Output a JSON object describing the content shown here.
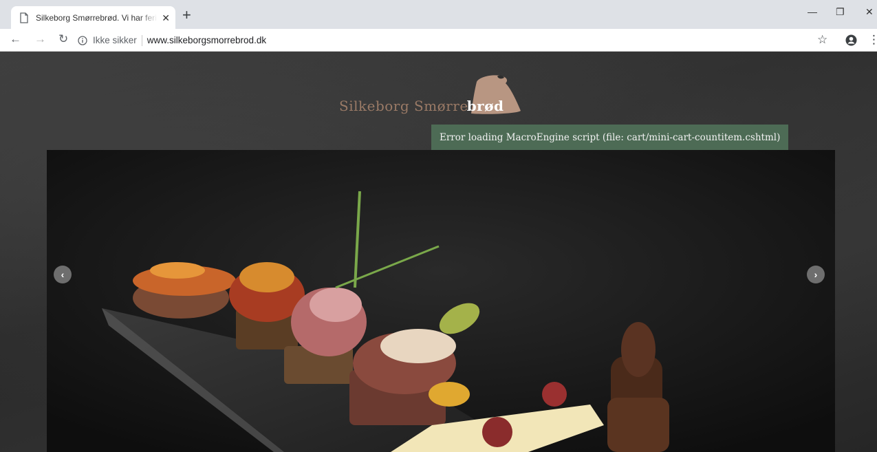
{
  "browser": {
    "tab_title": "Silkeborg Smørrebrød. Vi har ferie",
    "tab_close": "✕",
    "new_tab": "+",
    "minimize": "—",
    "restore": "❐",
    "close": "✕",
    "back": "←",
    "forward": "→",
    "reload": "↻",
    "security_label": "Ikke sikker",
    "url": "www.silkeborgsmorrebrod.dk",
    "bookmark": "☆",
    "menu": "⋮"
  },
  "site": {
    "logo_part1": "Silkeborg Smørre",
    "logo_part2": "brød",
    "error_message": "Error loading MacroEngine script (file: cart/mini-cart-countitem.cshtml)",
    "prev_arrow": "‹",
    "next_arrow": "›"
  },
  "colors": {
    "logo_brown": "#9a7a66",
    "bread_tan": "#b89682",
    "error_bg": "#4d6b55"
  },
  "icons": [
    "page-icon",
    "info-icon",
    "star-icon",
    "account-icon",
    "menu-icon"
  ]
}
